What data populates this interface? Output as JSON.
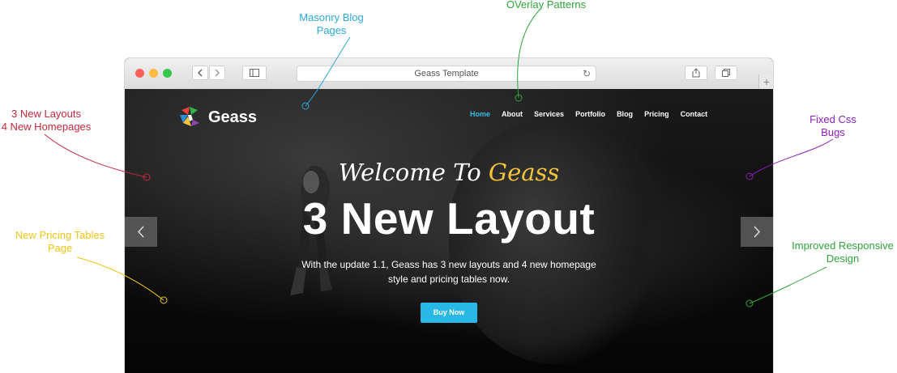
{
  "annotations": {
    "masonry": {
      "line1": "Masonry Blog",
      "line2": "Pages",
      "color": "#29a9d8"
    },
    "overlay": {
      "line1": "OVerlay Patterns",
      "color": "#2fa43a"
    },
    "layouts": {
      "line1": "3 New Layouts",
      "line2": "4 New Homepages",
      "color": "#c1283e"
    },
    "fixed_css": {
      "line1": "Fixed Css",
      "line2": "Bugs",
      "color": "#8b1fb8"
    },
    "pricing": {
      "line1": "New Pricing Tables",
      "line2": "Page",
      "color": "#f0c419"
    },
    "responsive": {
      "line1": "Improved Responsive",
      "line2": "Design",
      "color": "#2fa43a"
    }
  },
  "browser": {
    "title": "Geass Template",
    "back_icon": "chevron-left-icon",
    "forward_icon": "chevron-right-icon",
    "sidebar_icon": "sidebar-icon",
    "reload_icon": "reload-icon",
    "share_icon": "share-icon",
    "tabs_icon": "tabs-icon",
    "new_tab_label": "+"
  },
  "site": {
    "logo_text": "Geass",
    "nav": [
      "Home",
      "About",
      "Services",
      "Portfolio",
      "Blog",
      "Pricing",
      "Contact"
    ],
    "active_nav": "Home",
    "welcome_prefix": "Welcome To",
    "welcome_accent": "Geass",
    "headline": "3 New Layout",
    "sub_line1": "With the update 1.1, Geass has 3 new layouts and 4 new homepage",
    "sub_line2": "style and pricing tables now.",
    "cta": "Buy Now",
    "accent_color": "#27b8e8",
    "highlight_color": "#f3c43a"
  }
}
